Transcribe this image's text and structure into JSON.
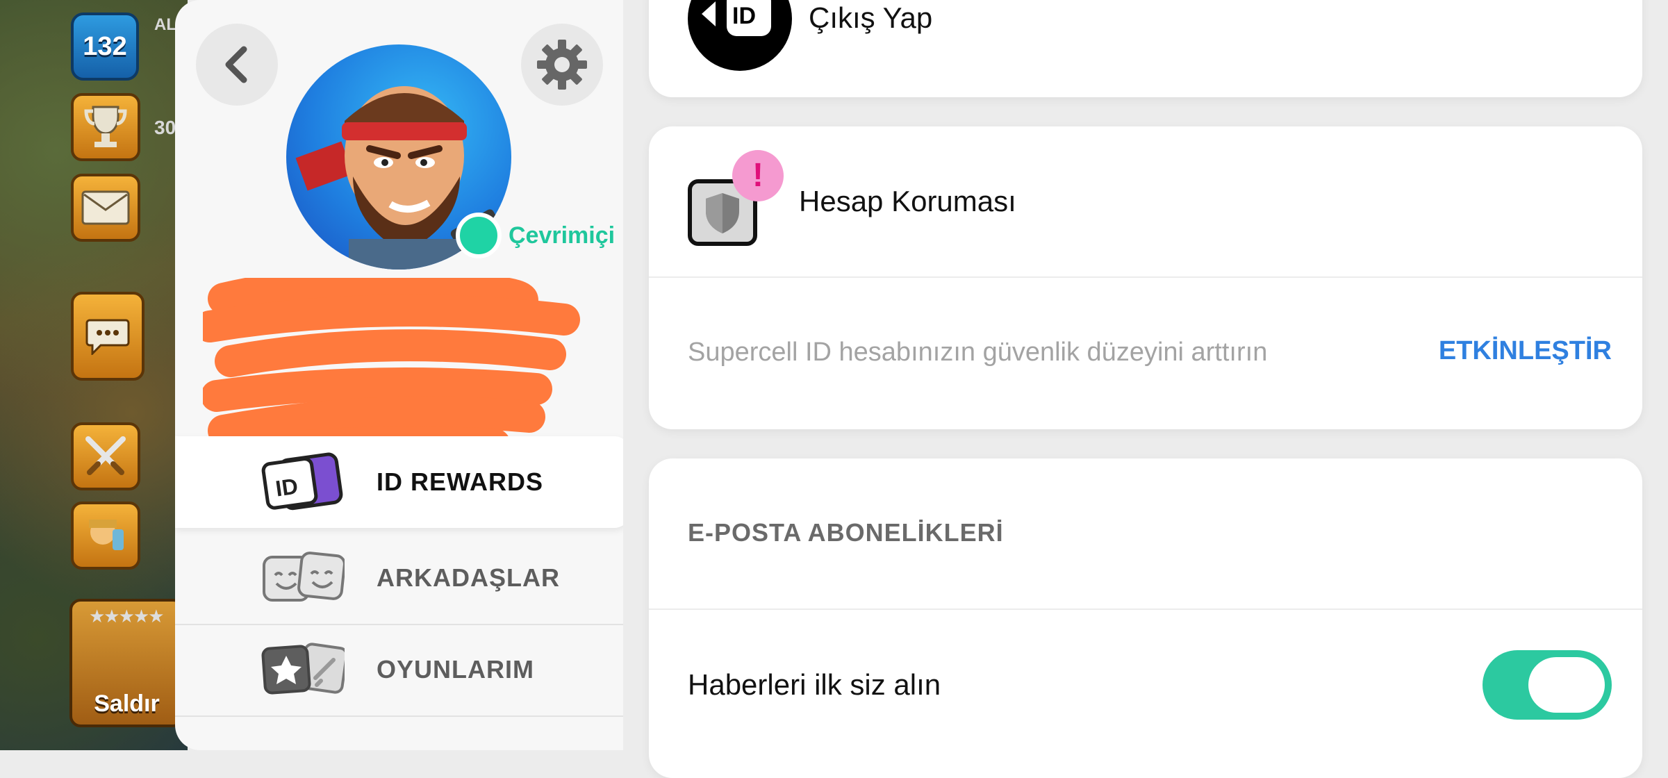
{
  "game_hud": {
    "level": "132",
    "label_top": "AL",
    "trophy_count": "30",
    "attack_label": "Saldır"
  },
  "profile": {
    "status": "Çevrimiçi",
    "status_color": "#1fd3a5"
  },
  "menu": {
    "items": [
      {
        "label": "ID REWARDS",
        "selected": true
      },
      {
        "label": "ARKADAŞLAR",
        "selected": false
      },
      {
        "label": "OYUNLARIM",
        "selected": false
      }
    ]
  },
  "settings": {
    "logout_label": "Çıkış Yap",
    "logout_icon_text": "ID",
    "protection": {
      "title": "Hesap Koruması",
      "badge": "!",
      "description": "Supercell ID hesabınızın güvenlik düzeyini arttırın",
      "action": "ETKİNLEŞTİR"
    },
    "email": {
      "section_title": "E-POSTA ABONELİKLERİ",
      "news_label": "Haberleri ilk siz alın",
      "news_enabled": true
    }
  },
  "colors": {
    "accent_green": "#2cc9a0",
    "link_blue": "#2f80e0",
    "alert_pink": "#f59ad0"
  }
}
